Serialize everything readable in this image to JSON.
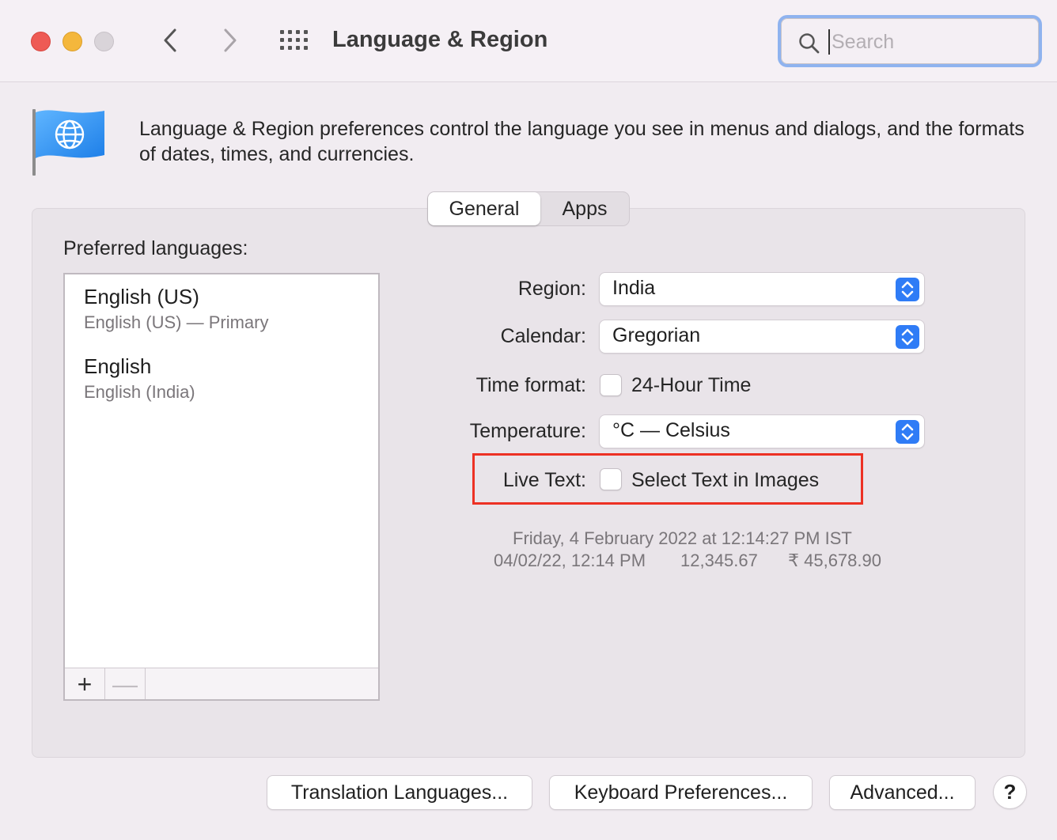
{
  "window": {
    "title": "Language & Region",
    "search_placeholder": "Search"
  },
  "header": {
    "description": "Language & Region preferences control the language you see in menus and dialogs, and the formats of dates, times, and currencies."
  },
  "tabs": [
    {
      "label": "General",
      "selected": true
    },
    {
      "label": "Apps",
      "selected": false
    }
  ],
  "preferred_languages": {
    "label": "Preferred languages:",
    "items": [
      {
        "name": "English (US)",
        "detail": "English (US) — Primary"
      },
      {
        "name": "English",
        "detail": "English (India)"
      }
    ],
    "add_label": "+",
    "remove_label": "—"
  },
  "settings": {
    "region": {
      "label": "Region:",
      "value": "India"
    },
    "calendar": {
      "label": "Calendar:",
      "value": "Gregorian"
    },
    "time_format": {
      "label": "Time format:",
      "option": "24-Hour Time",
      "checked": false
    },
    "temperature": {
      "label": "Temperature:",
      "value": "°C — Celsius"
    },
    "live_text": {
      "label": "Live Text:",
      "option": "Select Text in Images",
      "checked": false
    }
  },
  "sample": {
    "date_long": "Friday, 4 February 2022 at 12:14:27 PM IST",
    "date_short": "04/02/22, 12:14 PM",
    "number": "12,345.67",
    "currency": "₹ 45,678.90"
  },
  "buttons": {
    "translation": "Translation Languages...",
    "keyboard": "Keyboard Preferences...",
    "advanced": "Advanced...",
    "help": "?"
  },
  "colors": {
    "accent": "#2f7cf6",
    "highlight_box": "#ed3124",
    "close": "#ee5b55",
    "minimize": "#f4b73c"
  }
}
